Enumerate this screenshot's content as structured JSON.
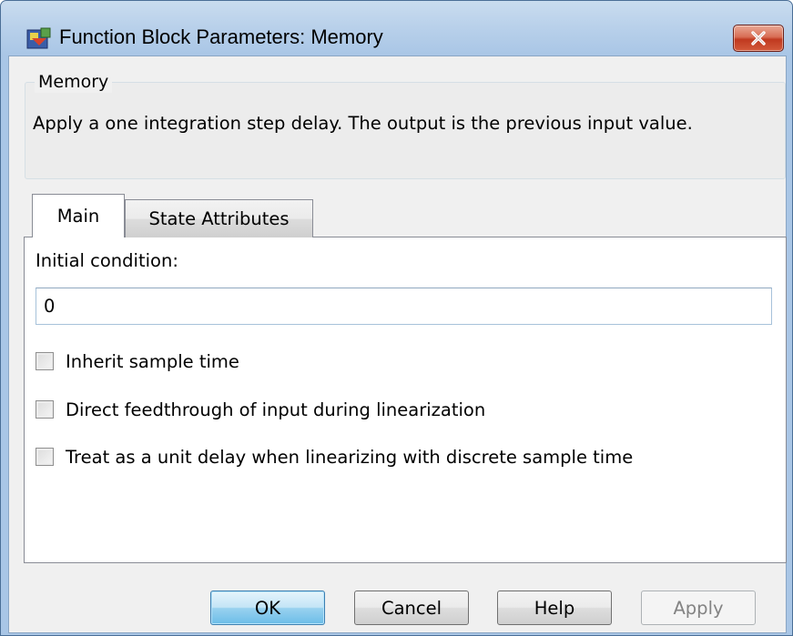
{
  "window": {
    "title": "Function Block Parameters: Memory"
  },
  "block": {
    "name": "Memory",
    "description": "Apply a one integration step delay. The output is the previous input value."
  },
  "tabs": [
    {
      "label": "Main",
      "selected": true
    },
    {
      "label": "State Attributes",
      "selected": false
    }
  ],
  "main_tab": {
    "initial_condition_label": "Initial condition:",
    "initial_condition_value": "0",
    "checkboxes": [
      {
        "label": "Inherit sample time",
        "checked": false
      },
      {
        "label": "Direct feedthrough of input during linearization",
        "checked": false
      },
      {
        "label": "Treat as a unit delay when linearizing with discrete sample time",
        "checked": false
      }
    ]
  },
  "buttons": {
    "ok": "OK",
    "cancel": "Cancel",
    "help": "Help",
    "apply": "Apply",
    "apply_enabled": false
  },
  "icons": {
    "app": "simulink-block-icon",
    "close": "close-icon"
  },
  "colors": {
    "title_bar": "#b8d0ea",
    "close_button": "#c7442b",
    "ok_button_border": "#3c7fb1",
    "dialog_background": "#f0f0f0"
  }
}
